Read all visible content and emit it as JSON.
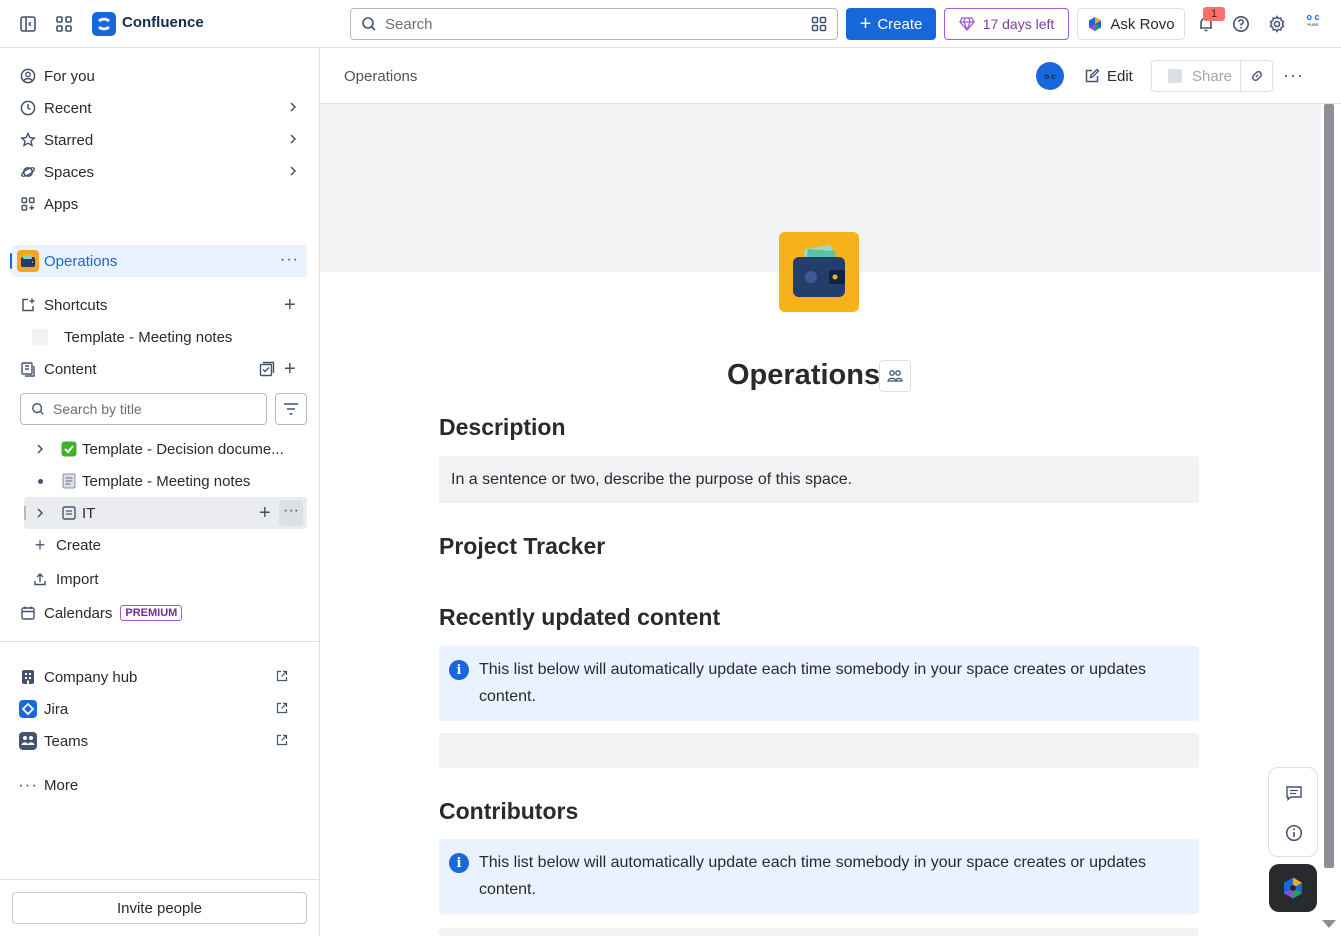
{
  "topbar": {
    "app_name": "Confluence",
    "search_placeholder": "Search",
    "create_label": "Create",
    "trial_label": "17 days left",
    "rovo_label": "Ask Rovo",
    "notification_count": "1",
    "avatar_initials_top": "o c",
    "avatar_initials_bottom": "PURE"
  },
  "sidebar": {
    "nav": [
      {
        "label": "For you",
        "icon": "person-circle-icon"
      },
      {
        "label": "Recent",
        "icon": "clock-icon"
      },
      {
        "label": "Starred",
        "icon": "star-icon"
      },
      {
        "label": "Spaces",
        "icon": "planet-icon"
      },
      {
        "label": "Apps",
        "icon": "apps-icon"
      }
    ],
    "space_name": "Operations",
    "shortcuts_label": "Shortcuts",
    "shortcut_item": "Template - Meeting notes",
    "content_label": "Content",
    "title_search_placeholder": "Search by title",
    "tree": [
      {
        "label": "Template - Decision docume...",
        "icon": "check-emoji-icon"
      },
      {
        "label": "Template - Meeting notes",
        "icon": "notepad-emoji-icon"
      },
      {
        "label": "IT",
        "icon": "page-icon"
      }
    ],
    "create_label": "Create",
    "import_label": "Import",
    "calendars_label": "Calendars",
    "premium_label": "PREMIUM",
    "apps_links": [
      {
        "label": "Company hub"
      },
      {
        "label": "Jira"
      },
      {
        "label": "Teams"
      }
    ],
    "more_label": "More",
    "invite_label": "Invite people"
  },
  "main": {
    "breadcrumb": "Operations",
    "owner_initials": "o c",
    "edit_label": "Edit",
    "share_label": "Share",
    "page_title": "Operations",
    "sections": {
      "description_heading": "Description",
      "description_text": "In a sentence or two, describe the purpose of this space.",
      "tracker_heading": "Project Tracker",
      "recent_heading": "Recently updated content",
      "recent_info": "This list below will automatically update each time somebody in your space creates or updates content.",
      "contributors_heading": "Contributors",
      "contributors_info": "This list below will automatically update each time somebody in your space creates or updates content."
    }
  },
  "colors": {
    "brand": "#1868db",
    "premium_purple": "#a05ad8",
    "space_icon_bg": "#f5b21b",
    "info_bg": "#e9f2fe"
  }
}
